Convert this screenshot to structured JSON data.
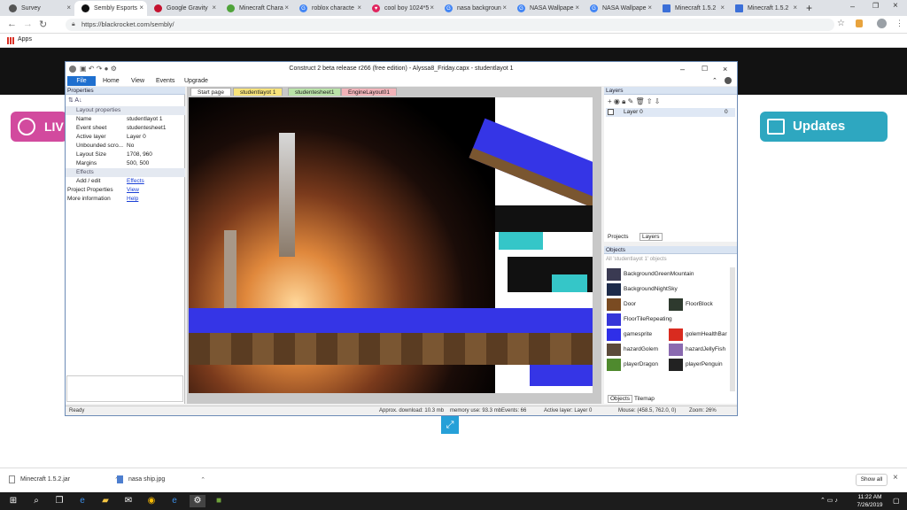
{
  "browser": {
    "tabs": [
      {
        "label": "Survey",
        "color": "#555555"
      },
      {
        "label": "Sembly Esports",
        "color": "#111111"
      },
      {
        "label": "Google Gravity",
        "color": "#c4122f"
      },
      {
        "label": "Minecraft Chara",
        "color": "#4fa33a"
      },
      {
        "label": "roblox characte",
        "color": "#4285f4"
      },
      {
        "label": "cool boy 1024*5",
        "color": "#e0245e"
      },
      {
        "label": "nasa backgroun",
        "color": "#4285f4"
      },
      {
        "label": "NASA Wallpape",
        "color": "#4285f4"
      },
      {
        "label": "NASA Wallpape",
        "color": "#4285f4"
      },
      {
        "label": "Minecraft 1.5.2",
        "color": "#3b6fd8"
      },
      {
        "label": "Minecraft 1.5.2",
        "color": "#3b6fd8"
      }
    ],
    "url": "https://blackrocket.com/sembly/",
    "bookmarks_label": "Apps"
  },
  "page": {
    "live_label": "LIV",
    "updates_label": "Updates"
  },
  "window": {
    "title": "Construct 2 beta release r266  (free edition) - Alyssa8_Friday.capx - studentlayot 1",
    "menu": {
      "file": "File",
      "home": "Home",
      "view": "View",
      "events": "Events",
      "upgrade": "Upgrade"
    }
  },
  "properties": {
    "header": "Properties",
    "section": "Layout properties",
    "rows": [
      {
        "k": "Name",
        "v": "studentlayot 1"
      },
      {
        "k": "Event sheet",
        "v": "studentesheet1"
      },
      {
        "k": "Active layer",
        "v": "Layer 0"
      },
      {
        "k": "Unbounded scro...",
        "v": "No"
      },
      {
        "k": "Layout Size",
        "v": "1708, 960"
      },
      {
        "k": "Margins",
        "v": "500, 500"
      }
    ],
    "effects_section": "Effects",
    "add_edit": "Add / edit",
    "effects_link": "Effects",
    "project_props": "Project Properties",
    "view_link": "View",
    "more_info": "More information",
    "help_link": "Help"
  },
  "doctabs": [
    {
      "label": "Start page",
      "color": "#ffffff"
    },
    {
      "label": "studentlayot 1",
      "color": "#f7e37a"
    },
    {
      "label": "studentesheet1",
      "color": "#b9e3a8"
    },
    {
      "label": "EngineLayout01",
      "color": "#f2b3b9"
    }
  ],
  "layers": {
    "header": "Layers",
    "items": [
      {
        "label": "Layer 0",
        "index": "0"
      }
    ],
    "tabs": [
      "Projects",
      "Layers"
    ]
  },
  "objects": {
    "header": "Objects",
    "filter": "All 'studentlayot 1' objects",
    "items": [
      {
        "label": "BackgroundGreenMountain",
        "color": "#3a3a52"
      },
      {
        "label": "BackgroundNightSky",
        "color": "#1d2b4a"
      },
      {
        "label": "Door",
        "color": "#7a4b22"
      },
      {
        "label": "FloorBlock",
        "color": "#2e3a2e"
      },
      {
        "label": "FloorTileRepeating",
        "color": "#3535d8"
      },
      {
        "label": "gamesprite",
        "color": "#2f2fe8"
      },
      {
        "label": "golemHealthBar",
        "color": "#d92b1f"
      },
      {
        "label": "hazardGolem",
        "color": "#5b4a3a"
      },
      {
        "label": "hazardJellyFish",
        "color": "#8a6ab0"
      },
      {
        "label": "playerDragon",
        "color": "#4f8a2e"
      },
      {
        "label": "playerPenguin",
        "color": "#222222"
      }
    ],
    "tabs": [
      "Objects",
      "Tilemap"
    ]
  },
  "status": {
    "ready": "Ready",
    "download": "Approx. download: 10.3 mb",
    "memory": "memory use: 93.3 mb",
    "events": "Events: 66",
    "layer": "Active layer: Layer 0",
    "mouse": "Mouse: (458.5, 762.0, 0)",
    "zoom": "Zoom: 26%"
  },
  "downloads": [
    {
      "label": "Minecraft 1.5.2.jar"
    },
    {
      "label": "nasa ship.jpg"
    }
  ],
  "show_all": "Show all",
  "taskbar": {
    "time": "11:22 AM",
    "date": "7/26/2019"
  }
}
